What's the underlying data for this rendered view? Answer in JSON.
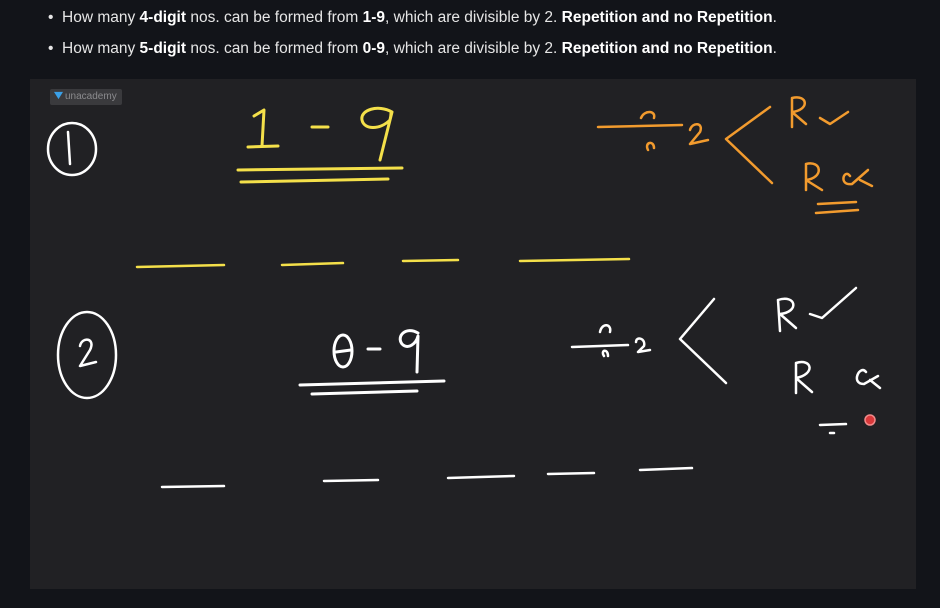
{
  "questions": [
    {
      "prefix": "How many ",
      "digits": "4-digit",
      "mid": " nos. can be formed from ",
      "range": "1-9",
      "suffix": ", which are divisible by 2. ",
      "emphasis": "Repetition and no Repetition",
      "end": "."
    },
    {
      "prefix": "How many ",
      "digits": "5-digit",
      "mid": " nos. can be formed from ",
      "range": "0-9",
      "suffix": ", which are divisible by 2. ",
      "emphasis": "Repetition and no Repetition",
      "end": "."
    }
  ],
  "whiteboard": {
    "logo_text": "unacademy",
    "logo_icon": "unacademy-logo-icon",
    "colors": {
      "background": "#212124",
      "yellow_ink": "#f4e04a",
      "orange_ink": "#f29b2e",
      "white_ink": "#ffffff",
      "pointer": "#d9383a"
    }
  }
}
